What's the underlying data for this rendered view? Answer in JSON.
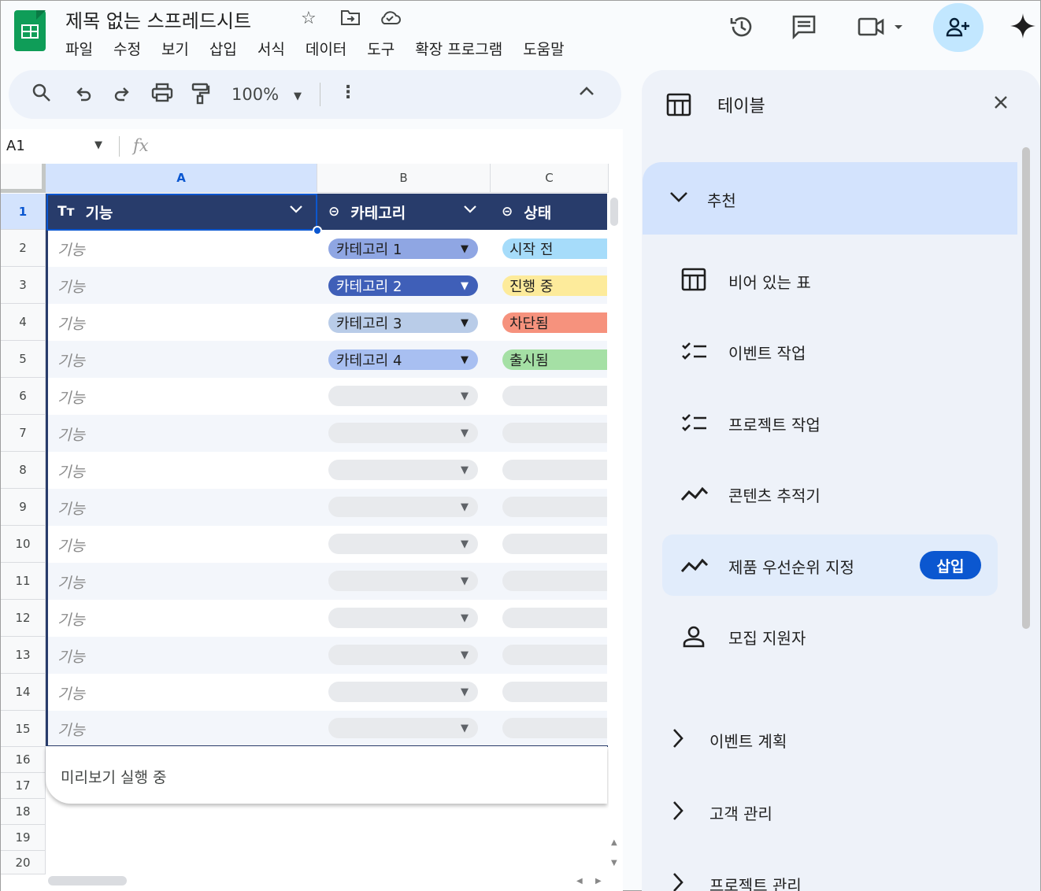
{
  "header": {
    "doc_title": "제목 없는 스프레드시트",
    "menu": [
      "파일",
      "수정",
      "보기",
      "삽입",
      "서식",
      "데이터",
      "도구",
      "확장 프로그램",
      "도움말"
    ]
  },
  "toolbar": {
    "zoom": "100%"
  },
  "formula_bar": {
    "cell_ref": "A1",
    "fx_label": "fx"
  },
  "grid": {
    "columns": [
      "A",
      "B",
      "C"
    ],
    "rows": [
      "1",
      "2",
      "3",
      "4",
      "5",
      "6",
      "7",
      "8",
      "9",
      "10",
      "11",
      "12",
      "13",
      "14",
      "15",
      "16",
      "17",
      "18",
      "19",
      "20"
    ],
    "table_headers": {
      "a": {
        "icon": "Tт",
        "label": "기능"
      },
      "b": {
        "icon": "⊝",
        "label": "카테고리"
      },
      "c": {
        "icon": "⊝",
        "label": "상태"
      }
    },
    "feature_placeholder": "기능",
    "categories": [
      {
        "label": "카테고리 1",
        "color": "#8fa6e3"
      },
      {
        "label": "카테고리 2",
        "color": "#3f5fb8"
      },
      {
        "label": "카테고리 3",
        "color": "#b9cce8"
      },
      {
        "label": "카테고리 4",
        "color": "#a8bff1"
      }
    ],
    "statuses": [
      {
        "label": "시작 전",
        "color": "#a6dcfa"
      },
      {
        "label": "진행 중",
        "color": "#fdeb9b"
      },
      {
        "label": "차단됨",
        "color": "#f6927d"
      },
      {
        "label": "출시됨",
        "color": "#a5e0a5"
      }
    ],
    "preview_text": "미리보기 실행 중"
  },
  "panel": {
    "title": "테이블",
    "recommended_label": "추천",
    "items": [
      {
        "label": "비어 있는 표",
        "icon": "table-icon"
      },
      {
        "label": "이벤트 작업",
        "icon": "checklist-icon"
      },
      {
        "label": "프로젝트 작업",
        "icon": "checklist-icon"
      },
      {
        "label": "콘텐츠 추적기",
        "icon": "trend-icon"
      },
      {
        "label": "제품 우선순위 지정",
        "icon": "trend-icon"
      },
      {
        "label": "모집 지원자",
        "icon": "person-icon"
      }
    ],
    "insert_label": "삽입",
    "sections": [
      "이벤트 계획",
      "고객 관리",
      "프로젝트 관리"
    ]
  }
}
